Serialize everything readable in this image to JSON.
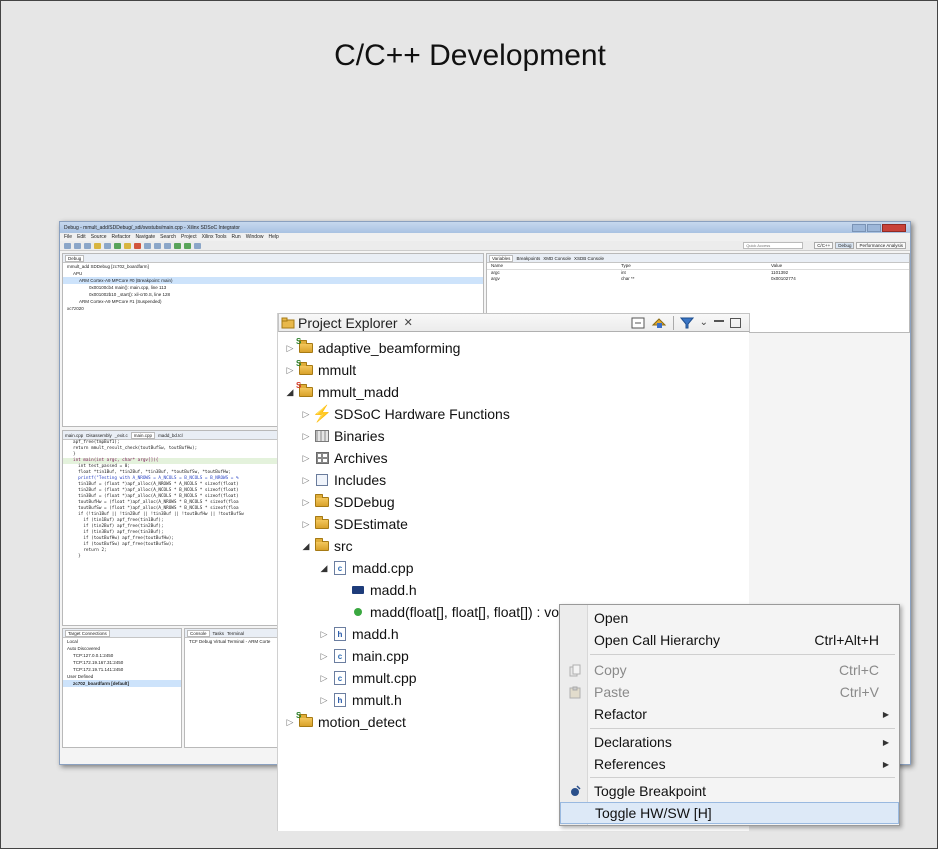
{
  "slide": {
    "title": "C/C++ Development"
  },
  "ide": {
    "window_title": "Debug - mmult_add/SDDebug/_sdi/swstubs/main.cpp - Xilinx SDSoC Integrator",
    "menu": [
      "File",
      "Edit",
      "Source",
      "Refactor",
      "Navigate",
      "Search",
      "Project",
      "Xilinx Tools",
      "Run",
      "Window",
      "Help"
    ],
    "quick_access": "Quick Access",
    "perspectives": [
      "C/C++",
      "Debug",
      "Performance Analysis"
    ],
    "debug_view": {
      "tab": "Debug",
      "items": [
        "mmult_add SDDebug [zc702_boardfarm]",
        "APU",
        "ARM Cortex-A9 MPCore #0 (Breakpoint: main)",
        "0x00100cb4 main(): main.cpp, line 113",
        "0x001002b10 _start(): xil-crt0.S, line 128",
        "ARM Cortex-A9 MPCore #1 (Suspended)",
        "xc7z020"
      ]
    },
    "variables_view": {
      "tabs": [
        "Variables",
        "Breakpoints",
        "XMD Console",
        "XSDB Console"
      ],
      "columns": [
        "Name",
        "Type",
        "Value"
      ],
      "rows": [
        {
          "name": "argc",
          "type": "int",
          "value": "1101392"
        },
        {
          "name": "argv",
          "type": "char **",
          "value": "0x00102774"
        }
      ]
    },
    "editor": {
      "tabs": [
        "main.cpp",
        "Disassembly",
        "_exit.c",
        "main.cpp",
        "madd_bd.tcl"
      ],
      "code": [
        "apf_free(tmpBuf1);",
        "",
        "return mmult_result_check(toutBufSw, toutBufHw);",
        "}",
        "",
        "int main(int argc, char* argv[]){",
        "  int test_passed = 0;",
        "  float *tin1Buf, *tin2Buf, *tin3Buf, *toutBufSw, *toutBufHw;",
        "",
        "  printf(\"Testing with A_NROWS = A_NCOLS = B_NCOLS = B_NROWS = %",
        "",
        "  tin1Buf = (float *)apf_alloc(A_NROWS * A_NCOLS * sizeof(float)",
        "  tin2Buf = (float *)apf_alloc(A_NCOLS * B_NCOLS * sizeof(float)",
        "  tin3Buf = (float *)apf_alloc(A_NCOLS * B_NCOLS * sizeof(float)",
        "  toutBufHw = (float *)apf_alloc(A_NROWS * B_NCOLS * sizeof(floa",
        "  toutBufSw = (float *)apf_alloc(A_NROWS * B_NCOLS * sizeof(floa",
        "",
        "  if (!tin1Buf || !tin2Buf || !tin3Buf || !toutBufHw || !toutBufSw",
        "    if (tin1Buf) apf_free(tin1Buf);",
        "    if (tin2Buf) apf_free(tin2Buf);",
        "    if (tin3Buf) apf_free(tin3Buf);",
        "    if (toutBufHw) apf_free(toutBufHw);",
        "    if (toutBufSw) apf_free(toutBufSw);",
        "    return 2;",
        "  }"
      ]
    },
    "target_connections": {
      "tab": "Target Connections",
      "items": [
        "Local",
        "Auto Discovered",
        "TCP:127.0.0.1:2450",
        "TCP:172.19.167.31:2450",
        "TCP:172.19.71.141:2450",
        "User Defined",
        "zc702_boardfarm [default]"
      ]
    },
    "console": {
      "tabs": [
        "Console",
        "Tasks",
        "Terminal"
      ],
      "text": "TCF Debug Virtual Terminal - ARM Corte"
    }
  },
  "project_explorer": {
    "title": "Project Explorer",
    "nodes": [
      {
        "label": "adaptive_beamforming"
      },
      {
        "label": "mmult"
      },
      {
        "label": "mmult_madd"
      },
      {
        "label": "SDSoC Hardware Functions"
      },
      {
        "label": "Binaries"
      },
      {
        "label": "Archives"
      },
      {
        "label": "Includes"
      },
      {
        "label": "SDDebug"
      },
      {
        "label": "SDEstimate"
      },
      {
        "label": "src"
      },
      {
        "label": "madd.cpp"
      },
      {
        "label": "madd.h"
      },
      {
        "label": "madd(float[], float[], float[]) : void [H]"
      },
      {
        "label": "madd.h"
      },
      {
        "label": "main.cpp"
      },
      {
        "label": "mmult.cpp"
      },
      {
        "label": "mmult.h"
      },
      {
        "label": "motion_detect"
      }
    ]
  },
  "context_menu": {
    "items": [
      {
        "label": "Open",
        "accel": ""
      },
      {
        "label": "Open Call Hierarchy",
        "accel": "Ctrl+Alt+H"
      },
      {
        "label": "Copy",
        "accel": "Ctrl+C"
      },
      {
        "label": "Paste",
        "accel": "Ctrl+V"
      },
      {
        "label": "Refactor",
        "accel": ""
      },
      {
        "label": "Declarations",
        "accel": ""
      },
      {
        "label": "References",
        "accel": ""
      },
      {
        "label": "Toggle Breakpoint",
        "accel": ""
      },
      {
        "label": "Toggle HW/SW [H]",
        "accel": ""
      }
    ]
  },
  "colors": {
    "highlight": "#dde9f7",
    "highlight_border": "#99b9e0",
    "folder": "#e8b84a",
    "project_badge": "#2b7f2b"
  }
}
